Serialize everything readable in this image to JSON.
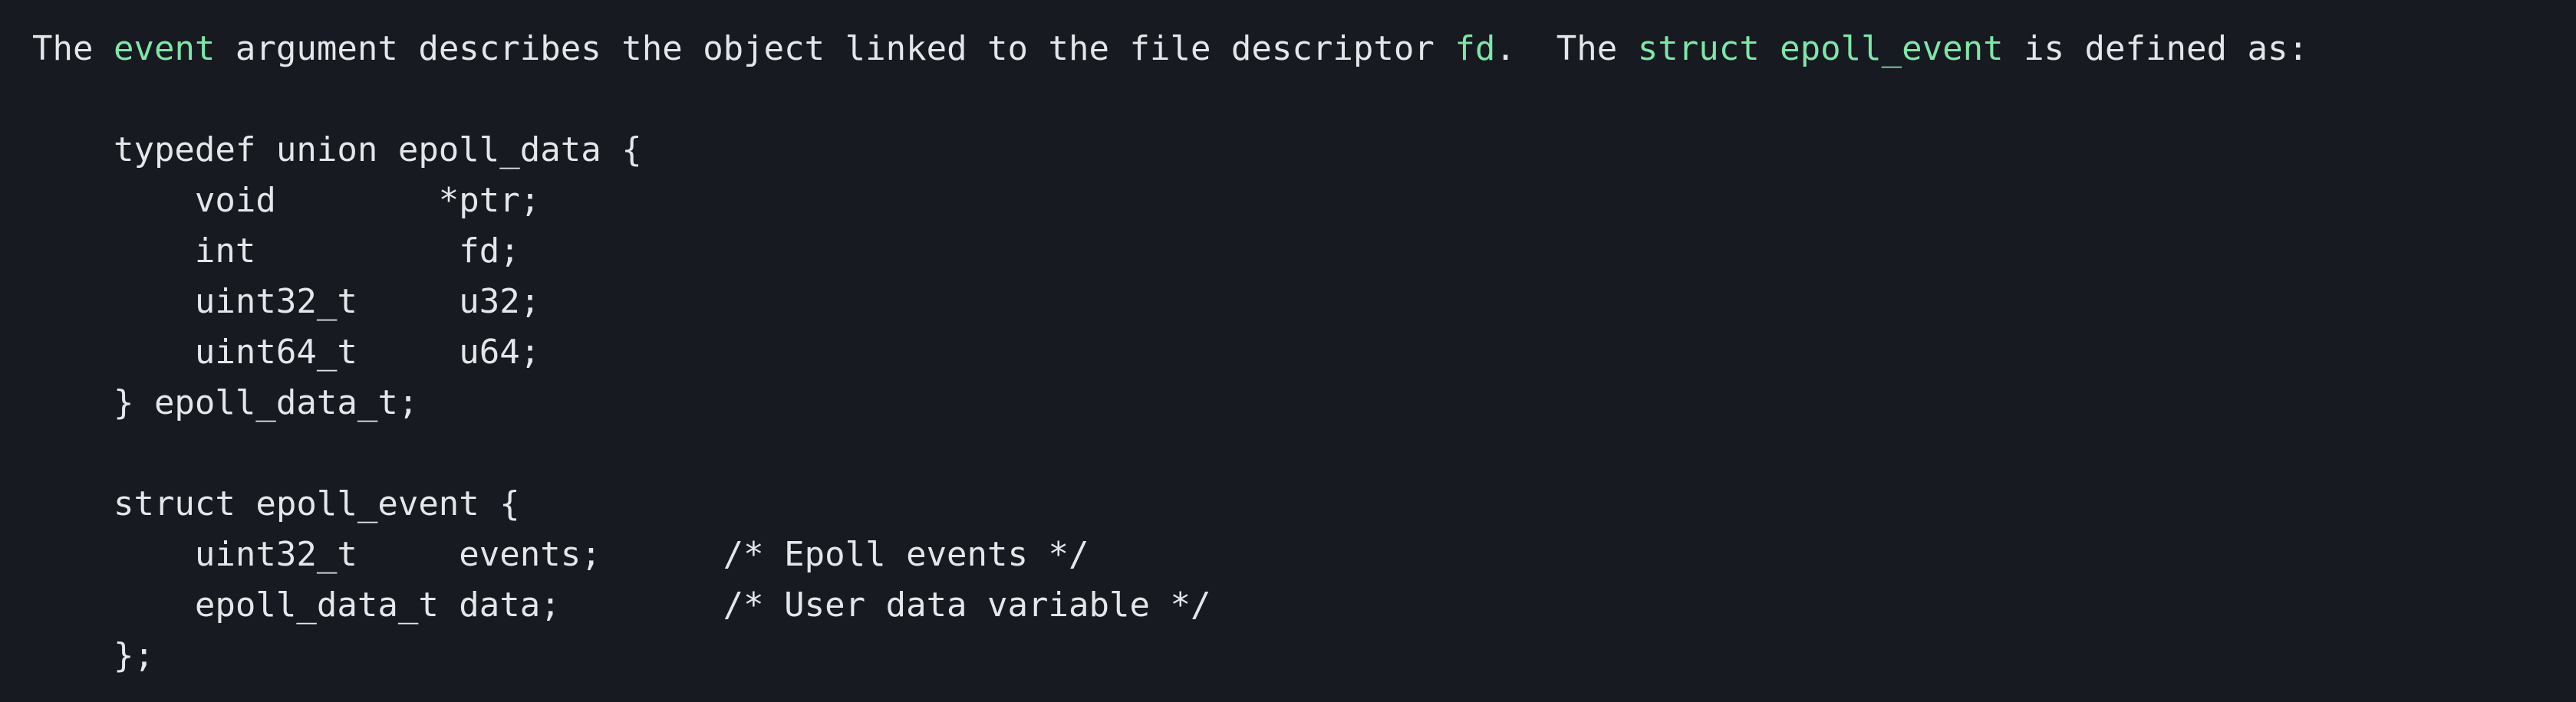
{
  "colors": {
    "background": "#171a20",
    "text": "#e4e6ea",
    "highlight": "#7ee6a8"
  },
  "intro": {
    "t1": "The ",
    "event": "event",
    "t2": " argument describes the object linked to the file descriptor ",
    "fd": "fd",
    "t3": ".  The ",
    "struct_name": "struct epoll_event",
    "t4": " is defined as:"
  },
  "code": {
    "union_open": "    typedef union epoll_data {",
    "union_ptr": "        void        *ptr;",
    "union_fd": "        int          fd;",
    "union_u32": "        uint32_t     u32;",
    "union_u64": "        uint64_t     u64;",
    "union_close": "    } epoll_data_t;",
    "struct_open": "    struct epoll_event {",
    "struct_events": "        uint32_t     events;      /* Epoll events */",
    "struct_data": "        epoll_data_t data;        /* User data variable */",
    "struct_close": "    };"
  }
}
